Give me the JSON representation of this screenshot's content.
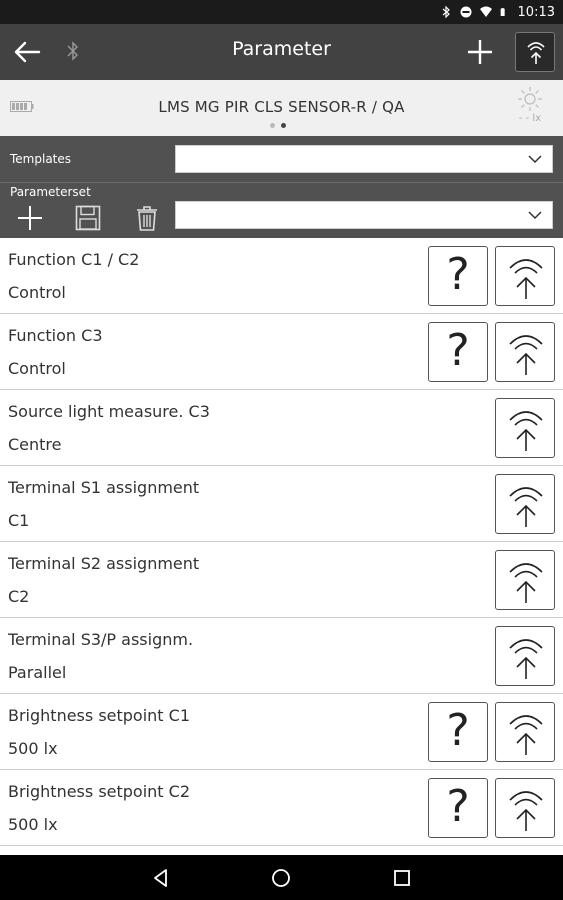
{
  "status_bar": {
    "time": "10:13",
    "icons": [
      "bluetooth-icon",
      "do-not-disturb-icon",
      "wifi-icon",
      "battery-icon"
    ]
  },
  "app_bar": {
    "title": "Parameter",
    "icons": [
      "back-arrow-icon",
      "bluetooth-icon",
      "plus-icon",
      "signal-upload-icon"
    ]
  },
  "device": {
    "name": "LMS MG PIR CLS SENSOR-R / QA",
    "lux_reading": "- - lx",
    "page_indicator": {
      "pages": 2,
      "active": 2
    }
  },
  "templates": {
    "label": "Templates",
    "selected": ""
  },
  "parameterset": {
    "label": "Parameterset",
    "selected": "",
    "tools": [
      "add-icon",
      "save-icon",
      "trash-icon"
    ]
  },
  "parameters": [
    {
      "name": "Function C1 / C2",
      "value": "Control",
      "has_help": true
    },
    {
      "name": "Function C3",
      "value": "Control",
      "has_help": true
    },
    {
      "name": "Source light measure. C3",
      "value": "Centre",
      "has_help": false
    },
    {
      "name": "Terminal S1 assignment",
      "value": "C1",
      "has_help": false
    },
    {
      "name": "Terminal S2 assignment",
      "value": "C2",
      "has_help": false
    },
    {
      "name": "Terminal S3/P assignm.",
      "value": "Parallel",
      "has_help": false
    },
    {
      "name": "Brightness setpoint C1",
      "value": "500 lx",
      "has_help": true
    },
    {
      "name": "Brightness setpoint C2",
      "value": "500 lx",
      "has_help": true
    }
  ],
  "help_glyph": "?",
  "colors": {
    "app_bar": "#424242",
    "status_bar": "#1b1b1b",
    "section_bg": "#515151",
    "device_bar": "#f0f0f0",
    "nav_bar": "#000000"
  }
}
